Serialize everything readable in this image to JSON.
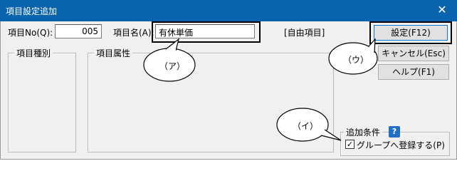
{
  "window": {
    "title": "項目設定追加",
    "close_glyph": "✕"
  },
  "item_no": {
    "label": "項目No(Q):",
    "value": "005"
  },
  "item_name": {
    "label": "項目名(A):",
    "value": "有休単価"
  },
  "free_item_tag": "[自由項目]",
  "groups": {
    "item_type": "項目種別",
    "item_attr": "項目属性",
    "add_condition": "追加条件"
  },
  "buttons": {
    "set": "設定(F12)",
    "cancel": "キャンセル(Esc)",
    "help": "ヘルプ(F1)"
  },
  "add_condition": {
    "help_mark": "?",
    "register_group_label": "グループへ登録する(P)",
    "register_group_checked": true
  },
  "callouts": {
    "a": "（ア）",
    "i": "（イ）",
    "u": "（ウ）"
  }
}
